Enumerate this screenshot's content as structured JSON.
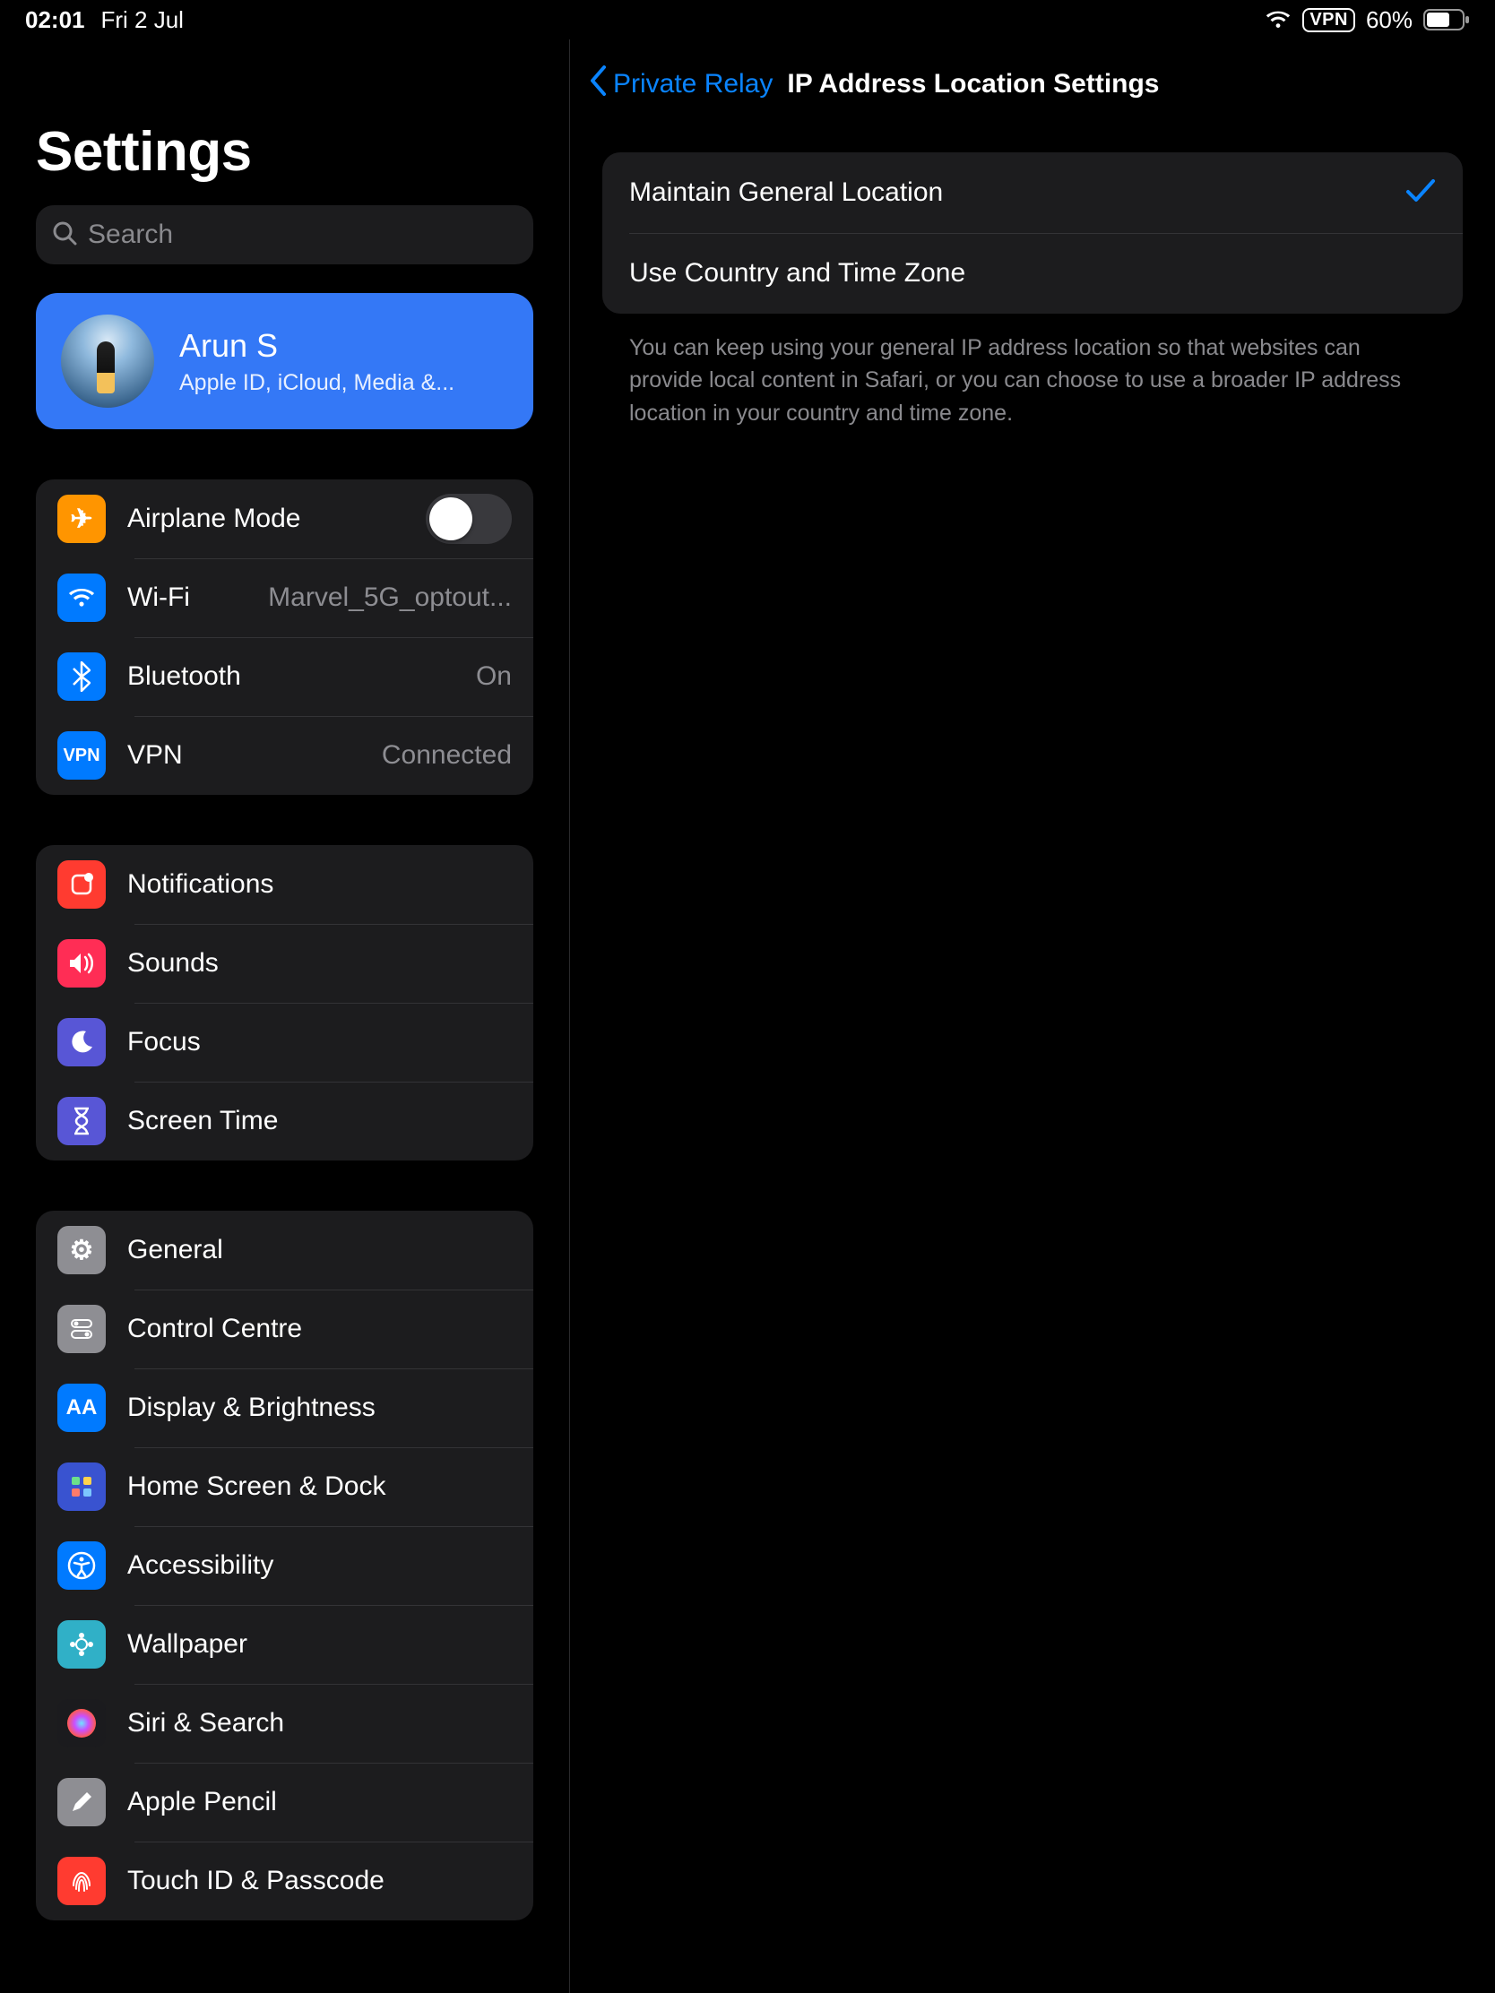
{
  "status": {
    "time": "02:01",
    "date": "Fri 2 Jul",
    "vpn_badge": "VPN",
    "battery_pct": "60%"
  },
  "sidebar": {
    "title": "Settings",
    "search_placeholder": "Search",
    "profile": {
      "name": "Arun S",
      "subtitle": "Apple ID, iCloud, Media &..."
    },
    "g1": {
      "airplane": "Airplane Mode",
      "wifi": "Wi-Fi",
      "wifi_value": "Marvel_5G_optout...",
      "bluetooth": "Bluetooth",
      "bluetooth_value": "On",
      "vpn": "VPN",
      "vpn_value": "Connected"
    },
    "g2": {
      "notifications": "Notifications",
      "sounds": "Sounds",
      "focus": "Focus",
      "screentime": "Screen Time"
    },
    "g3": {
      "general": "General",
      "control": "Control Centre",
      "display": "Display & Brightness",
      "home": "Home Screen & Dock",
      "accessibility": "Accessibility",
      "wallpaper": "Wallpaper",
      "siri": "Siri & Search",
      "pencil": "Apple Pencil",
      "touchid": "Touch ID & Passcode"
    }
  },
  "detail": {
    "back_label": "Private Relay",
    "title": "IP Address Location Settings",
    "options": {
      "maintain": "Maintain General Location",
      "country": "Use Country and Time Zone"
    },
    "footer": "You can keep using your general IP address location so that websites can provide local content in Safari, or you can choose to use a broader IP address location in your country and time zone."
  }
}
